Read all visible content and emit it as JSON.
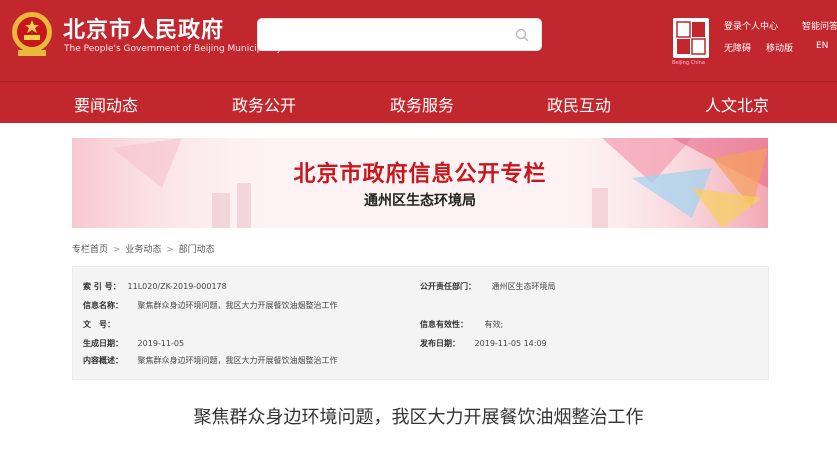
{
  "header": {
    "site_title_zh": "北京市人民政府",
    "site_title_en": "The People's Government of Beijing Municipality",
    "search_placeholder": "",
    "capital_logo_caption": "Beijing China",
    "links": {
      "login": "登录个人中心",
      "smart": "智能问答",
      "barrier_free": "无障碍",
      "mobile": "移动版",
      "english": "EN"
    }
  },
  "nav": {
    "items": [
      "要闻动态",
      "政务公开",
      "政务服务",
      "政民互动",
      "人文北京"
    ]
  },
  "banner": {
    "title": "北京市政府信息公开专栏",
    "subtitle": "通州区生态环境局"
  },
  "breadcrumb": [
    "专栏首页",
    "业务动态",
    "部门动态"
  ],
  "info": {
    "index_label": "索 引 号：",
    "index_value": "11L020/ZK-2019-000178",
    "dept_label": "公开责任部门：",
    "dept_value": "通州区生态环境局",
    "name_label": "信息名称：",
    "name_value": "聚焦群众身边环境问题，我区大力开展餐饮油烟整治工作",
    "docno_label": "文　号：",
    "docno_value": "",
    "validity_label": "信息有效性：",
    "validity_value": "有效;",
    "created_label": "生成日期：",
    "created_value": "2019-11-05",
    "published_label": "发布日期：",
    "published_value": "2019-11-05 14:09",
    "summary_label": "内容概述：",
    "summary_value": "聚焦群众身边环境问题，我区大力开展餐饮油烟整治工作"
  },
  "article": {
    "title": "聚焦群众身边环境问题，我区大力开展餐饮油烟整治工作"
  },
  "colors": {
    "brand_red": "#c1272d",
    "banner_red": "#c8161d"
  }
}
